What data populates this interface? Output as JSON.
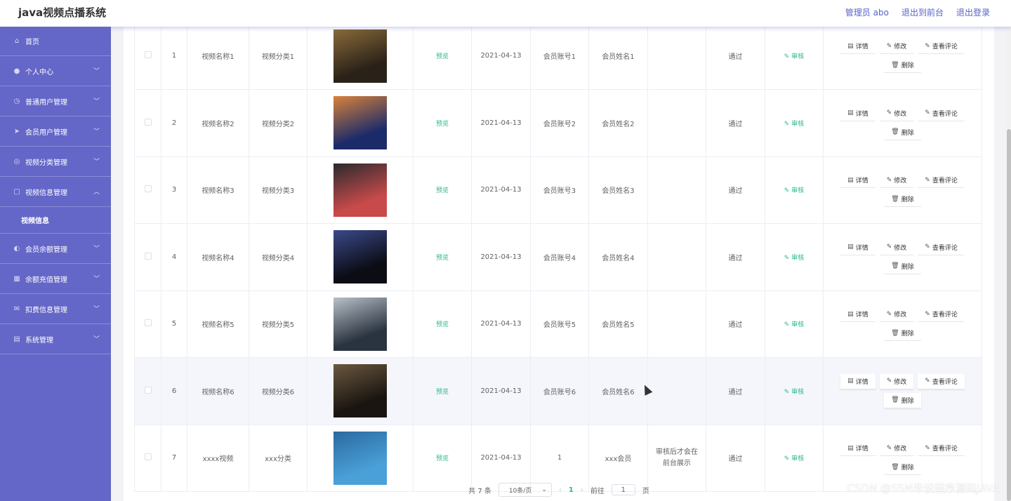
{
  "header": {
    "title": "java视频点播系统",
    "admin_label": "管理员 abo",
    "front_link": "退出到前台",
    "logout_link": "退出登录"
  },
  "sidebar": {
    "items": [
      {
        "label": "首页",
        "icon": "home-icon"
      },
      {
        "label": "个人中心",
        "icon": "user-icon"
      },
      {
        "label": "普通用户管理",
        "icon": "clock-icon"
      },
      {
        "label": "会员用户管理",
        "icon": "send-icon"
      },
      {
        "label": "视频分类管理",
        "icon": "globe-icon"
      },
      {
        "label": "视频信息管理",
        "icon": "square-icon"
      },
      {
        "label": "视频信息",
        "icon": ""
      },
      {
        "label": "会员余额管理",
        "icon": "mic-icon"
      },
      {
        "label": "余额充值管理",
        "icon": "grid-icon"
      },
      {
        "label": "扣费信息管理",
        "icon": "mail-icon"
      },
      {
        "label": "系统管理",
        "icon": "doc-icon"
      }
    ]
  },
  "table": {
    "preview_label": "预览",
    "audit_label": "审核",
    "ops": {
      "detail": "详情",
      "edit": "修改",
      "comments": "查看评论",
      "delete": "删除"
    },
    "rows": [
      {
        "idx": "1",
        "name": "视频名称1",
        "category": "视频分类1",
        "date": "2021-04-13",
        "account": "会员账号1",
        "member_name": "会员姓名1",
        "note": "",
        "status": "通过",
        "poster_colors": [
          "#2a2218",
          "#8a6a3a"
        ]
      },
      {
        "idx": "2",
        "name": "视频名称2",
        "category": "视频分类2",
        "date": "2021-04-13",
        "account": "会员账号2",
        "member_name": "会员姓名2",
        "note": "",
        "status": "通过",
        "poster_colors": [
          "#1b2b6a",
          "#d9823a"
        ]
      },
      {
        "idx": "3",
        "name": "视频名称3",
        "category": "视频分类3",
        "date": "2021-04-13",
        "account": "会员账号3",
        "member_name": "会员姓名3",
        "note": "",
        "status": "通过",
        "poster_colors": [
          "#c84a4a",
          "#2a2a2e"
        ]
      },
      {
        "idx": "4",
        "name": "视频名称4",
        "category": "视频分类4",
        "date": "2021-04-13",
        "account": "会员账号4",
        "member_name": "会员姓名4",
        "note": "",
        "status": "通过",
        "poster_colors": [
          "#0c0c14",
          "#3a4a8a"
        ]
      },
      {
        "idx": "5",
        "name": "视频名称5",
        "category": "视频分类5",
        "date": "2021-04-13",
        "account": "会员账号5",
        "member_name": "会员姓名5",
        "note": "",
        "status": "通过",
        "poster_colors": [
          "#2a3440",
          "#b8c0c8"
        ]
      },
      {
        "idx": "6",
        "name": "视频名称6",
        "category": "视频分类6",
        "date": "2021-04-13",
        "account": "会员账号6",
        "member_name": "会员姓名6",
        "note": "",
        "status": "通过",
        "poster_colors": [
          "#1a1510",
          "#6a5840"
        ]
      },
      {
        "idx": "7",
        "name": "xxxx视频",
        "category": "xxx分类",
        "date": "2021-04-13",
        "account": "1",
        "member_name": "xxx会员",
        "note": "审核后才会在前台展示",
        "status": "通过",
        "poster_colors": [
          "#4aa0d8",
          "#2a6aa0"
        ]
      }
    ]
  },
  "pagination": {
    "total_label": "共 7 条",
    "page_size": "10条/页",
    "current_page": "1",
    "goto_label": "前往",
    "goto_value": "1",
    "page_suffix": "页"
  },
  "watermark": "CSDN @SSM毕设程序源码JAVA"
}
